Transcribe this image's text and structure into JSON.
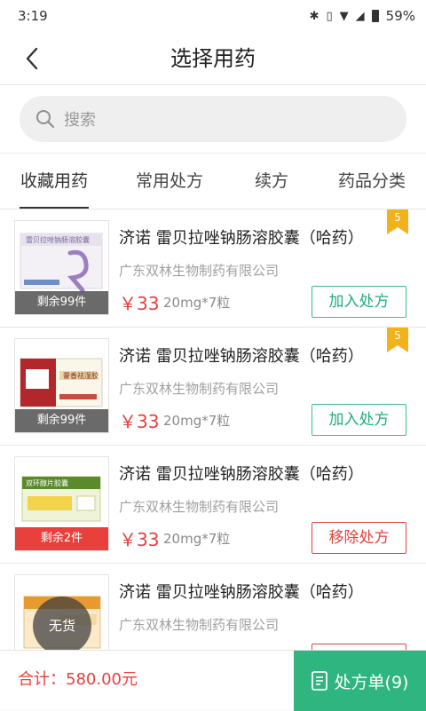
{
  "status": {
    "time": "3:19",
    "battery": "59%"
  },
  "header": {
    "title": "选择用药"
  },
  "search": {
    "placeholder": "搜索"
  },
  "tabs": [
    {
      "label": "收藏用药",
      "active": true
    },
    {
      "label": "常用处方",
      "active": false
    },
    {
      "label": "续方",
      "active": false
    },
    {
      "label": "药品分类",
      "active": false
    }
  ],
  "items": [
    {
      "name": "济诺 雷贝拉唑钠肠溶胶囊（哈药）",
      "maker": "广东双林生物制药有限公司",
      "price": "￥33",
      "spec": "20mg*7粒",
      "remain": "剩余99件",
      "remain_color": "gray",
      "badge": "5",
      "action": "加入处方",
      "action_type": "add"
    },
    {
      "name": "济诺 雷贝拉唑钠肠溶胶囊（哈药）",
      "maker": "广东双林生物制药有限公司",
      "price": "￥33",
      "spec": "20mg*7粒",
      "remain": "剩余99件",
      "remain_color": "gray",
      "badge": "5",
      "action": "加入处方",
      "action_type": "add"
    },
    {
      "name": "济诺 雷贝拉唑钠肠溶胶囊（哈药）",
      "maker": "广东双林生物制药有限公司",
      "price": "￥33",
      "spec": "20mg*7粒",
      "remain": "剩余2件",
      "remain_color": "red",
      "badge": "",
      "action": "移除处方",
      "action_type": "remove"
    },
    {
      "name": "济诺 雷贝拉唑钠肠溶胶囊（哈药）",
      "maker": "广东双林生物制药有限公司",
      "price": "",
      "spec": "",
      "remain": "",
      "remain_color": "",
      "badge": "",
      "action": "",
      "action_type": "remove"
    }
  ],
  "floating_label": "无货",
  "footer": {
    "total": "合计：580.00元",
    "prescription": "处方单(9)"
  },
  "colors": {
    "green": "#2fb57f",
    "red": "#e8403d",
    "badge": "#f2b21b"
  }
}
